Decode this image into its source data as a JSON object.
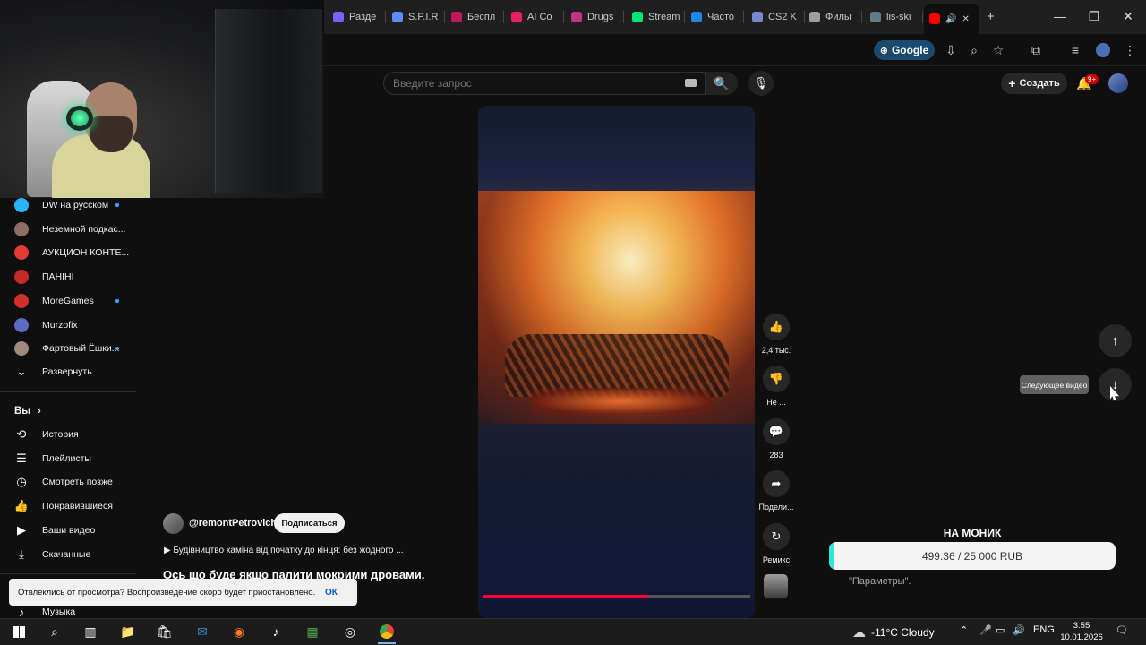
{
  "browser": {
    "tabs": [
      {
        "label": "Разде",
        "color": "#7b61ff"
      },
      {
        "label": "S.P.I.R",
        "color": "#5e8bff"
      },
      {
        "label": "Беспл",
        "color": "#c2185b"
      },
      {
        "label": "AI Co",
        "color": "#e91e63"
      },
      {
        "label": "Drugs",
        "color": "#c13584"
      },
      {
        "label": "Stream",
        "color": "#00e676"
      },
      {
        "label": "Часто",
        "color": "#1e88e5"
      },
      {
        "label": "CS2 K",
        "color": "#7986cb"
      },
      {
        "label": "Филы",
        "color": "#9e9e9e"
      },
      {
        "label": "lis-ski",
        "color": "#607d8b"
      }
    ],
    "google_chip": "Google",
    "window_controls": {
      "minimize": "—",
      "maximize": "❐",
      "close": "✕"
    }
  },
  "header": {
    "search_placeholder": "Введите запрос",
    "create_label": "Создать",
    "notifications_badge": "9+"
  },
  "sidebar": {
    "subscriptions": [
      {
        "label": "DW на русском",
        "color": "#29b6f6",
        "live": true
      },
      {
        "label": "Неземной подкас...",
        "color": "#8d6e63",
        "live": false
      },
      {
        "label": "АУКЦИОН КОНТЕ...",
        "color": "#e53935",
        "live": false
      },
      {
        "label": "ПАНІНІ",
        "color": "#c62828",
        "live": false
      },
      {
        "label": "MoreGames",
        "color": "#d32f2f",
        "live": true
      },
      {
        "label": "Murzofix",
        "color": "#5c6bc0",
        "live": false
      },
      {
        "label": "Фартовый Ёшки...",
        "color": "#a1887f",
        "live": true
      }
    ],
    "expand_label": "Развернуть",
    "you_label": "Вы",
    "you_items": [
      {
        "label": "История",
        "icon": "history-icon"
      },
      {
        "label": "Плейлисты",
        "icon": "playlist-icon"
      },
      {
        "label": "Смотреть позже",
        "icon": "clock-icon"
      },
      {
        "label": "Понравившиеся",
        "icon": "like-icon"
      },
      {
        "label": "Ваши видео",
        "icon": "video-icon"
      },
      {
        "label": "Скачанные",
        "icon": "download-icon"
      }
    ],
    "music_label": "Музыка"
  },
  "video": {
    "channel": "@remontPetrovich",
    "subscribe_label": "Подписаться",
    "music": "▶ Будівництво каміна від початку до кінця: без жодного ...",
    "title": "Ось що буде якщо палити мокрими дровами.",
    "progress": 0.62,
    "actions": {
      "likes": "2,4 тыс.",
      "dislike": "Не ...",
      "comments": "283",
      "share": "Подели...",
      "remix": "Ремикс"
    },
    "next_tooltip": "Следующее видео"
  },
  "donation": {
    "title": "НА МОНИК",
    "text": "499.36 / 25 000 RUB",
    "fraction": 0.02,
    "params_text": "\"Параметры\"."
  },
  "snackbar": {
    "text": "Отвлеклись от просмотра? Воспроизведение скоро будет приостановлено.",
    "ok": "ОК"
  },
  "taskbar": {
    "weather": "-11°C Cloudy",
    "language": "ENG",
    "time": "3:55",
    "date": "10.01.2026"
  }
}
